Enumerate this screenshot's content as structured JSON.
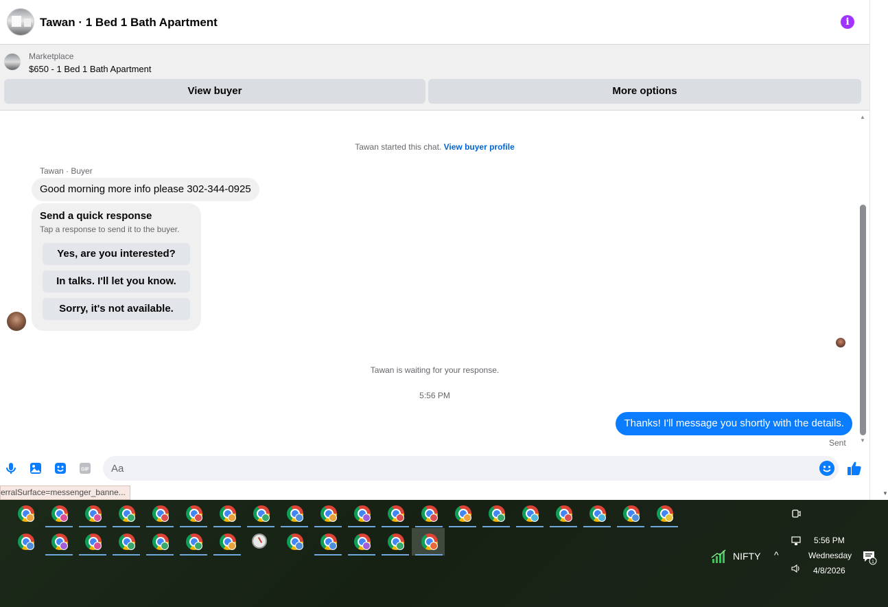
{
  "header": {
    "title": "Tawan · 1 Bed 1 Bath Apartment",
    "info_icon": "info-icon",
    "accent_color": "#a033ff"
  },
  "marketplace": {
    "label": "Marketplace",
    "listing": "$650 - 1 Bed 1 Bath Apartment",
    "view_buyer": "View buyer",
    "more_options": "More options"
  },
  "chat": {
    "started_text": "Tawan started this chat.",
    "view_profile": "View buyer profile",
    "sender_label": "Tawan · Buyer",
    "incoming_message": "Good morning more info please 302-344-0925",
    "quick_response": {
      "title": "Send a quick response",
      "subtitle": "Tap a response to send it to the buyer.",
      "options": [
        "Yes, are you interested?",
        "In talks. I'll let you know.",
        "Sorry, it's not available."
      ]
    },
    "waiting_text": "Tawan is waiting for your response.",
    "timestamp": "5:56 PM",
    "outgoing_message": "Thanks! I'll message you shortly with the details.",
    "sent_label": "Sent",
    "outgoing_color": "#0a7cff"
  },
  "composer": {
    "placeholder": "Aa",
    "tools": [
      "microphone-icon",
      "photo-icon",
      "sticker-icon",
      "gif-icon"
    ],
    "gif_label": "GIF"
  },
  "status_url": "erralSurface=messenger_banne...",
  "taskbar": {
    "row1_badges": [
      "#e8a33c",
      "#d94f9a",
      "#d94f9a",
      "#3aa86b",
      "#d94f4f",
      "#d94f4f",
      "#e8a33c",
      "#3aa86b",
      "#4f8fd9",
      "#e8a33c",
      "#a05fd9",
      "#d94f4f",
      "#d94f4f",
      "#e8a33c",
      "#3aa86b",
      "#4fb4d9",
      "#d94f4f",
      "#4fb4d9",
      "#4f8fd9",
      "#e8c33c"
    ],
    "row2_badges": [
      "#4f8fd9",
      "#a05fd9",
      "#d94f9a",
      "#3aa86b",
      "#3aa86b",
      "#3aa86b",
      "#e8a33c",
      "clock",
      "#4f8fd9",
      "#4f8fd9",
      "#a05fd9",
      "#3aa86b",
      "#e86a3c"
    ],
    "nifty_label": "NIFTY",
    "time": "5:56 PM",
    "day": "Wednesday",
    "date": "4/8/2026",
    "notification_count": "1"
  }
}
